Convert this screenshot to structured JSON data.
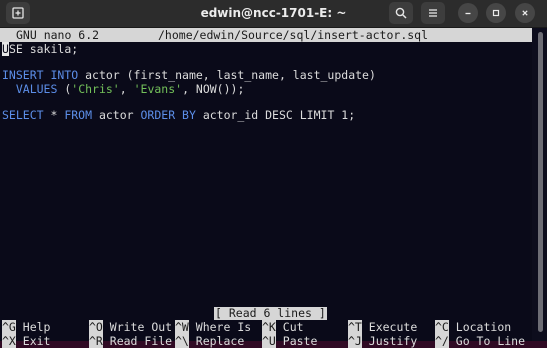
{
  "window": {
    "title": "edwin@ncc-1701-E: ~",
    "icons": [
      "new-tab-icon",
      "search-icon",
      "menu-icon",
      "minimize-icon",
      "maximize-icon",
      "close-icon"
    ]
  },
  "nano": {
    "version_label": "GNU nano 6.2",
    "file_path": "/home/edwin/Source/sql/insert-actor.sql",
    "status": "[ Read 6 lines ]"
  },
  "code": {
    "line1_cursor": "U",
    "line1_rest": "SE sakila;",
    "line3": {
      "kw": "INSERT INTO",
      "text": " actor (first_name, last_name, last_update)"
    },
    "line4": {
      "indent": "  ",
      "kw": "VALUES",
      "open": " (",
      "str1": "'Chris'",
      "sep": ", ",
      "str2": "'Evans'",
      "close": ", NOW());"
    },
    "line6": {
      "kw1": "SELECT",
      "t1": " * ",
      "kw2": "FROM",
      "t2": " actor ",
      "kw3": "ORDER BY",
      "t3": " actor_id DESC LIMIT 1;"
    }
  },
  "shortcuts_row1": [
    {
      "key": "^G",
      "label": " Help"
    },
    {
      "key": "^O",
      "label": " Write Out"
    },
    {
      "key": "^W",
      "label": " Where Is"
    },
    {
      "key": "^K",
      "label": " Cut"
    },
    {
      "key": "^T",
      "label": " Execute"
    },
    {
      "key": "^C",
      "label": " Location"
    }
  ],
  "shortcuts_row2": [
    {
      "key": "^X",
      "label": " Exit"
    },
    {
      "key": "^R",
      "label": " Read File"
    },
    {
      "key": "^\\",
      "label": " Replace"
    },
    {
      "key": "^U",
      "label": " Paste"
    },
    {
      "key": "^J",
      "label": " Justify"
    },
    {
      "key": "^/",
      "label": " Go To Line"
    }
  ],
  "colors": {
    "terminal_bg": "#0a0a19",
    "keyword": "#5c8ee8",
    "string": "#73c05a",
    "header_bg": "#d6d6d6"
  }
}
